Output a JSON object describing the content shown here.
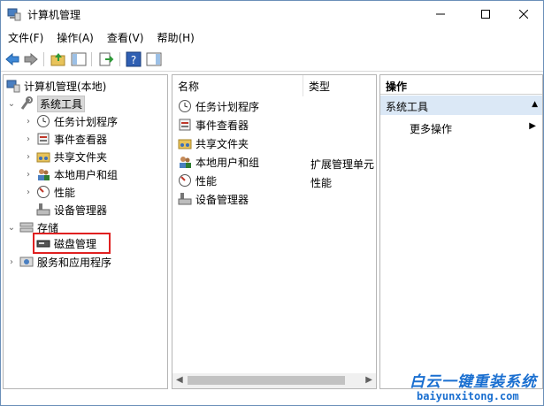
{
  "window": {
    "title": "计算机管理"
  },
  "menu": [
    "文件(F)",
    "操作(A)",
    "查看(V)",
    "帮助(H)"
  ],
  "tree": {
    "root": "计算机管理(本地)",
    "system_tools": "系统工具",
    "system_children": [
      "任务计划程序",
      "事件查看器",
      "共享文件夹",
      "本地用户和组",
      "性能",
      "设备管理器"
    ],
    "storage": "存储",
    "disk": "磁盘管理",
    "services": "服务和应用程序"
  },
  "list": {
    "col_name": "名称",
    "col_type": "类型",
    "rows": [
      {
        "name": "任务计划程序",
        "type": ""
      },
      {
        "name": "事件查看器",
        "type": ""
      },
      {
        "name": "共享文件夹",
        "type": ""
      },
      {
        "name": "本地用户和组",
        "type": "扩展管理单元"
      },
      {
        "name": "性能",
        "type": "性能"
      },
      {
        "name": "设备管理器",
        "type": ""
      }
    ]
  },
  "actions": {
    "header": "操作",
    "section": "系统工具",
    "more": "更多操作"
  },
  "watermark": {
    "cn": "白云一键重装系统",
    "en": "baiyunxitong.com"
  },
  "colors": {
    "selection": "#d9d9d9",
    "highlight_box": "#e02020",
    "action_section": "#dbe8f6",
    "watermark": "#1a6fd0"
  }
}
